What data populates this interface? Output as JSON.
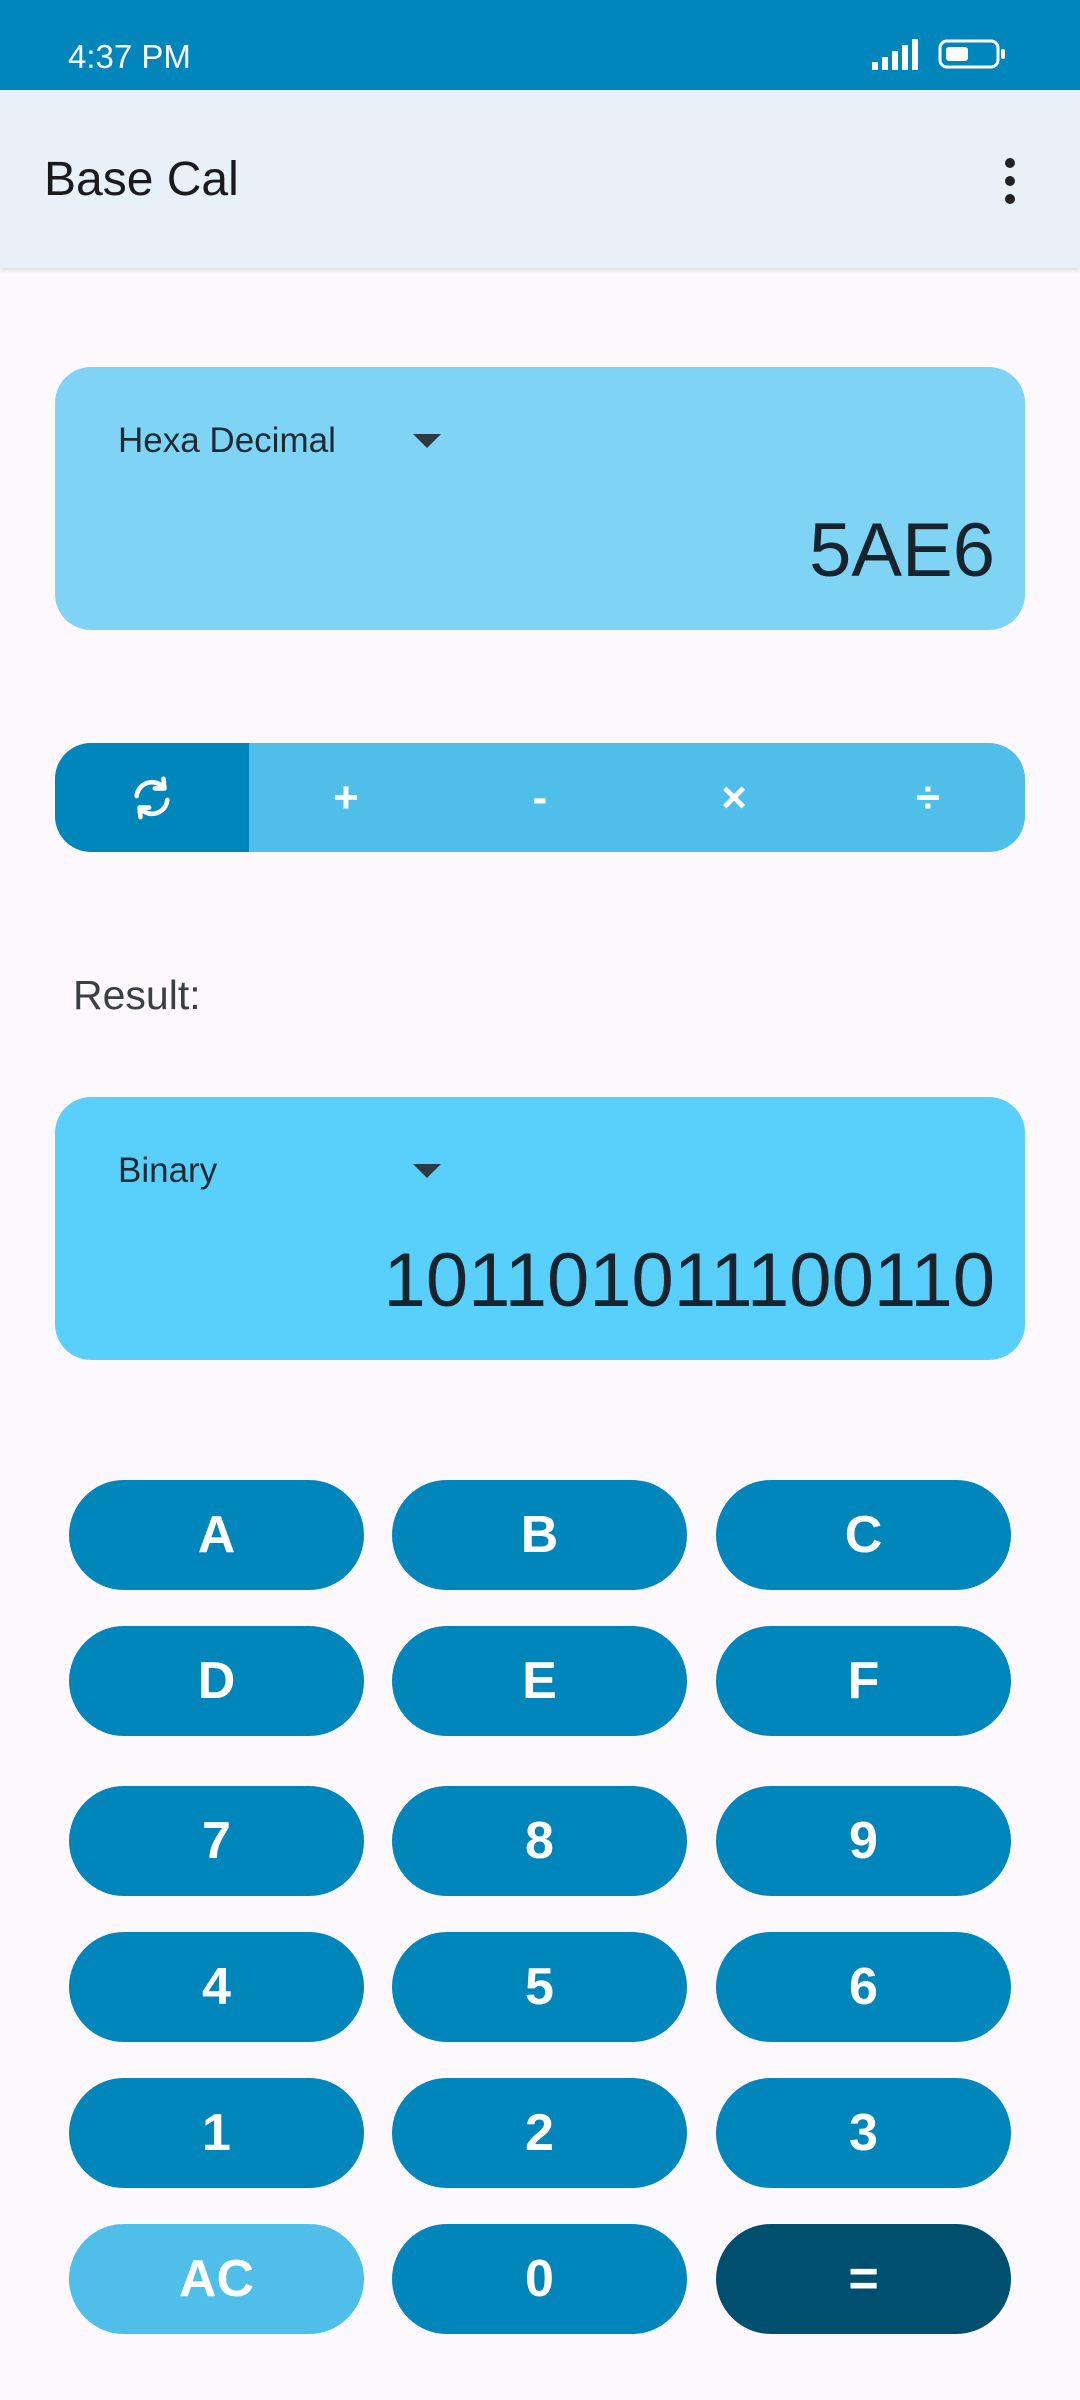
{
  "status": {
    "time": "4:37 PM"
  },
  "app": {
    "title": "Base Cal"
  },
  "input": {
    "base": "Hexa Decimal",
    "value": "5AE6"
  },
  "operations": [
    {
      "label": "",
      "icon": "swap-convert-icon",
      "active": true
    },
    {
      "label": "+"
    },
    {
      "label": "-"
    },
    {
      "label": "×"
    },
    {
      "label": "÷"
    }
  ],
  "result": {
    "label": "Result:",
    "base": "Binary",
    "value": "101101011100110"
  },
  "keypad": {
    "rows": [
      [
        "A",
        "B",
        "C"
      ],
      [
        "D",
        "E",
        "F"
      ],
      [
        "7",
        "8",
        "9"
      ],
      [
        "4",
        "5",
        "6"
      ],
      [
        "1",
        "2",
        "3"
      ],
      [
        "AC",
        "0",
        "="
      ]
    ]
  },
  "colors": {
    "primary": "#0086bb",
    "light": "#4fbfe9",
    "dark": "#004f6e"
  }
}
